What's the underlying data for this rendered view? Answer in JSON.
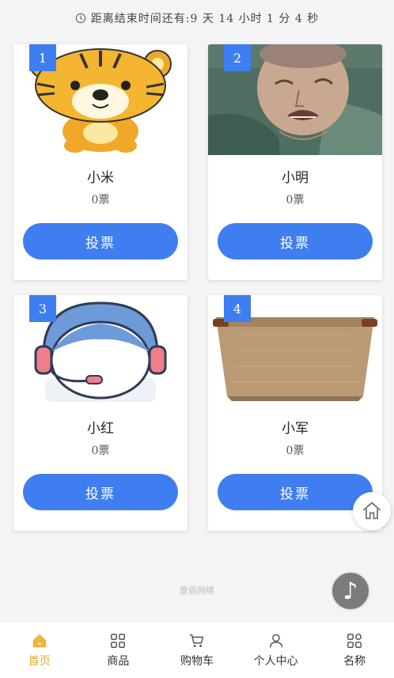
{
  "countdown": {
    "text": "距离结束时间还有:9 天 14 小时 1 分 4 秒",
    "icon": "clock-icon"
  },
  "candidates": [
    {
      "rank": "1",
      "name": "小米",
      "votes": "0票",
      "vote_label": "投票"
    },
    {
      "rank": "2",
      "name": "小明",
      "votes": "0票",
      "vote_label": "投票"
    },
    {
      "rank": "3",
      "name": "小红",
      "votes": "0票",
      "vote_label": "投票"
    },
    {
      "rank": "4",
      "name": "小军",
      "votes": "0票",
      "vote_label": "投票"
    }
  ],
  "footer": {
    "brand": "壹佰网络"
  },
  "floating": {
    "home_icon": "home-icon",
    "music_icon": "music-note-icon"
  },
  "tabs": [
    {
      "label": "首页",
      "icon": "home-icon",
      "active": true
    },
    {
      "label": "商品",
      "icon": "grid-icon",
      "active": false
    },
    {
      "label": "购物车",
      "icon": "cart-icon",
      "active": false
    },
    {
      "label": "个人中心",
      "icon": "user-icon",
      "active": false
    },
    {
      "label": "名称",
      "icon": "apps-icon",
      "active": false
    }
  ],
  "colors": {
    "accent": "#3f7ef0",
    "active_tab": "#e0a92f"
  }
}
